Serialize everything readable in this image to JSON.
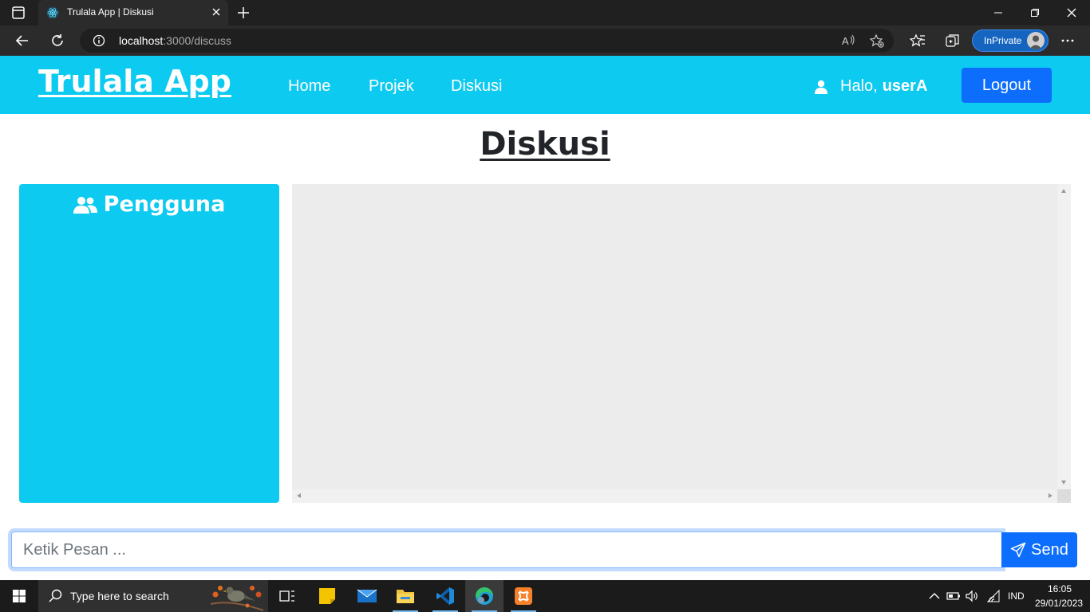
{
  "browser": {
    "tab_title": "Trulala App | Diskusi",
    "url_host": "localhost",
    "url_path": ":3000/discuss",
    "inprivate_label": "InPrivate"
  },
  "navbar": {
    "brand": "Trulala App",
    "links": [
      "Home",
      "Projek",
      "Diskusi"
    ],
    "greeting": "Halo,",
    "username": "userA",
    "logout_label": "Logout",
    "bg_color": "#0dcaf0"
  },
  "main": {
    "title": "Diskusi",
    "users_panel_title": "Pengguna"
  },
  "composer": {
    "placeholder": "Ketik Pesan ...",
    "send_label": "Send"
  },
  "taskbar": {
    "search_placeholder": "Type here to search",
    "language": "IND",
    "time": "16:05",
    "date": "29/01/2023"
  }
}
